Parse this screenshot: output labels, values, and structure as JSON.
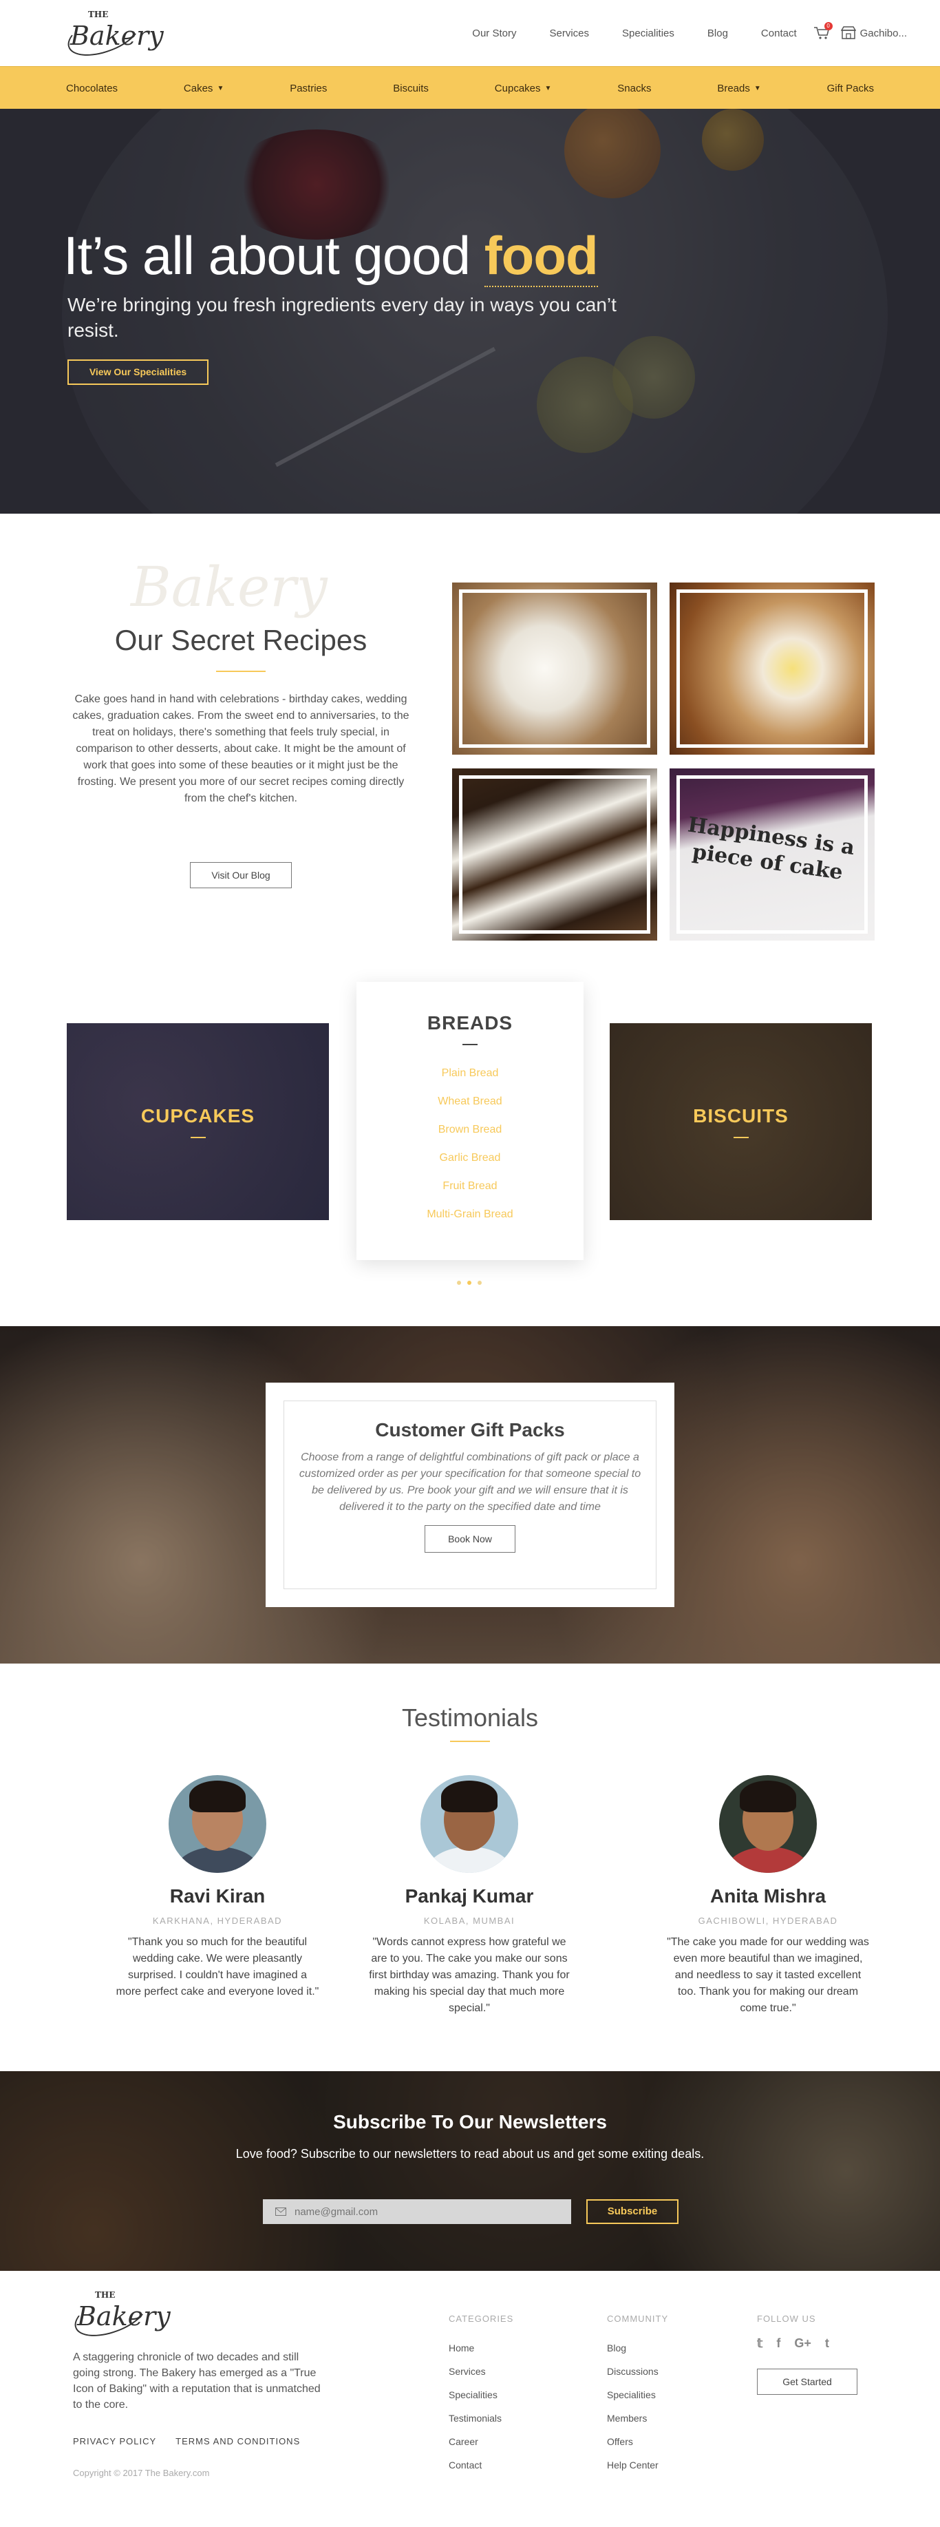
{
  "header": {
    "logo_top": "THE",
    "logo_script": "Bakery",
    "nav": [
      "Our Story",
      "Services",
      "Specialities",
      "Blog",
      "Contact"
    ],
    "cart_count": "0",
    "location": "Gachibo..."
  },
  "categories_bar": {
    "items": [
      {
        "label": "Chocolates",
        "dropdown": false
      },
      {
        "label": "Cakes",
        "dropdown": true
      },
      {
        "label": "Pastries",
        "dropdown": false
      },
      {
        "label": "Biscuits",
        "dropdown": false
      },
      {
        "label": "Cupcakes",
        "dropdown": true
      },
      {
        "label": "Snacks",
        "dropdown": false
      },
      {
        "label": "Breads",
        "dropdown": true
      },
      {
        "label": "Gift Packs",
        "dropdown": false
      }
    ]
  },
  "hero": {
    "title_pre": "It’s all about good ",
    "title_highlight": "food",
    "subtitle": "We’re bringing you fresh ingredients every day in ways you can’t resist.",
    "cta": "View Our Specialities"
  },
  "recipes": {
    "title": "Our Secret Recipes",
    "body": "Cake goes hand in hand with celebrations - birthday cakes, wedding cakes, graduation cakes. From the sweet end to anniversaries, to the treat on holidays, there's something that feels truly special, in comparison to other desserts, about cake. It might be the amount of work that goes into some of these beauties or it might just be the frosting. We present you more of our secret recipes coming directly from the chef's kitchen.",
    "cta": "Visit Our Blog",
    "tile_caption": "Happiness is a piece of cake"
  },
  "carousel": {
    "left_card": "CUPCAKES",
    "center_title": "BREADS",
    "center_items": [
      "Plain Bread",
      "Wheat Bread",
      "Brown Bread",
      "Garlic Bread",
      "Fruit Bread",
      "Multi-Grain Bread"
    ],
    "right_card": "BISCUITS"
  },
  "gift": {
    "title": "Customer Gift Packs",
    "body": "Choose from a range of delightful combinations of gift pack or place a customized order as per your specification for that someone special to be delivered by us. Pre book your gift and we will ensure that it is delivered it to the party on the specified date and time",
    "cta": "Book Now"
  },
  "testimonials": {
    "title": "Testimonials",
    "people": [
      {
        "name": "Ravi Kiran",
        "location": "KARKHANA, HYDERABAD",
        "quote": "\"Thank you so much for the beautiful wedding cake. We were pleasantly surprised. I couldn't have imagined a more perfect cake and everyone loved it.\""
      },
      {
        "name": "Pankaj Kumar",
        "location": "KOLABA, MUMBAI",
        "quote": "\"Words cannot express how grateful we are to you. The cake you make our sons first birthday was amazing. Thank you for making his special day that much more special.\""
      },
      {
        "name": "Anita Mishra",
        "location": "GACHIBOWLI, HYDERABAD",
        "quote": "\"The cake you made for our wedding was even more beautiful than we imagined, and needless to say it tasted excellent too. Thank you for making our dream come true.\""
      }
    ]
  },
  "newsletter": {
    "title": "Subscribe To Our Newsletters",
    "text": "Love food? Subscribe to our newsletters to read about us and get some exiting deals.",
    "placeholder": "name@gmail.com",
    "cta": "Subscribe"
  },
  "footer": {
    "about": "A staggering chronicle of two decades and still going strong. The Bakery has emerged as a \"True Icon of Baking\" with a reputation that is unmatched to the core.",
    "privacy": "PRIVACY POLICY",
    "terms": "TERMS AND CONDITIONS",
    "copyright": "Copyright © 2017 The Bakery.com",
    "categories_title": "CATEGORIES",
    "categories": [
      "Home",
      "Services",
      "Specialities",
      "Testimonials",
      "Career",
      "Contact"
    ],
    "community_title": "COMMUNITY",
    "community": [
      "Blog",
      "Discussions",
      "Specialities",
      "Members",
      "Offers",
      "Help Center"
    ],
    "follow_title": "FOLLOW US",
    "social_icons": [
      "twitter-icon",
      "facebook-icon",
      "google-plus-icon",
      "tumblr-icon"
    ],
    "social_glyphs": [
      "𝕥",
      "f",
      "G+",
      "t"
    ],
    "cta": "Get Started"
  },
  "colors": {
    "accent": "#f7c95a",
    "dark": "#2e2f36"
  }
}
